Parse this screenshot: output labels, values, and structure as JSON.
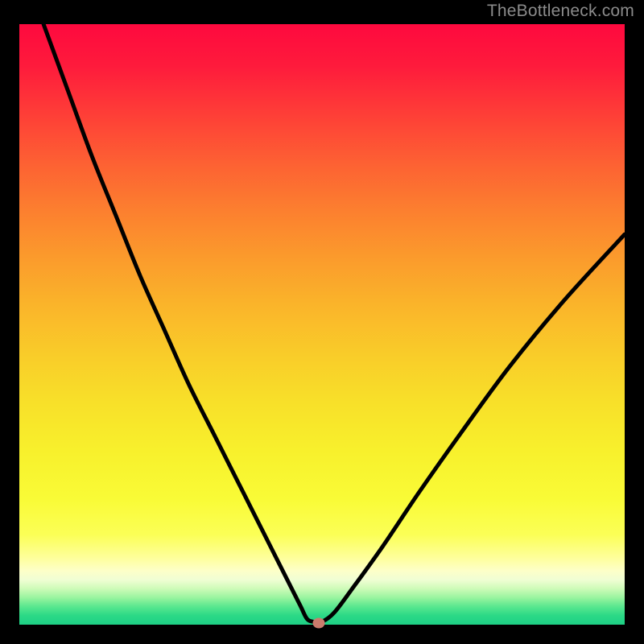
{
  "watermark": "TheBottleneck.com",
  "chart_data": {
    "type": "line",
    "title": "",
    "xlabel": "",
    "ylabel": "",
    "xlim": [
      0,
      100
    ],
    "ylim": [
      0,
      100
    ],
    "series": [
      {
        "name": "bottleneck-curve",
        "x": [
          4,
          8,
          12,
          16,
          20,
          24,
          28,
          32,
          36,
          40,
          43,
          45,
          46.5,
          47.5,
          48.5,
          50,
          52,
          55,
          60,
          66,
          73,
          81,
          90,
          100
        ],
        "y": [
          100,
          89,
          78,
          68,
          58,
          49,
          40,
          32,
          24,
          16,
          10,
          6,
          3,
          1,
          0.5,
          0.5,
          2,
          6,
          13,
          22,
          32,
          43,
          54,
          65
        ]
      }
    ],
    "marker": {
      "x": 49.5,
      "y": 0.3,
      "color": "#cb7b6c"
    },
    "gradient_stops": [
      {
        "pos": 0,
        "color": "#fe093e"
      },
      {
        "pos": 0.5,
        "color": "#f9cc29"
      },
      {
        "pos": 0.8,
        "color": "#f9fb36"
      },
      {
        "pos": 0.92,
        "color": "#f0fed4"
      },
      {
        "pos": 1.0,
        "color": "#1ed085"
      }
    ]
  }
}
